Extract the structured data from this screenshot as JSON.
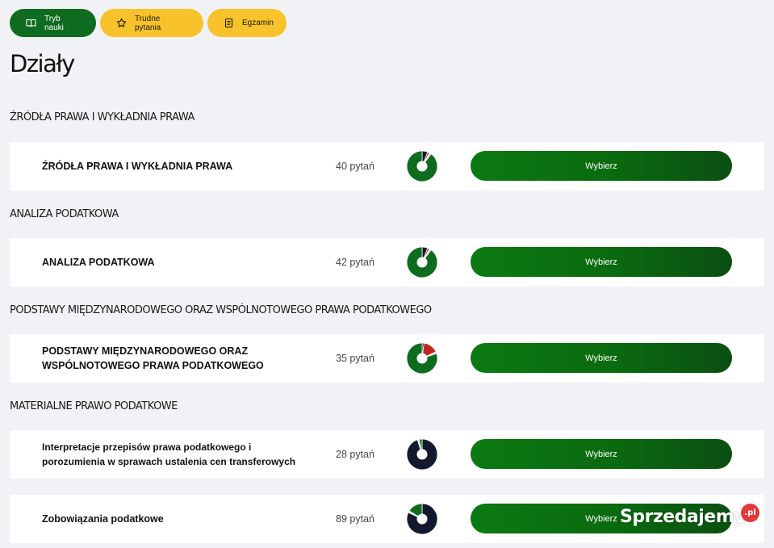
{
  "tabs": [
    {
      "label": "Tryb nauki",
      "icon": "book-icon"
    },
    {
      "label": "Trudne pytania",
      "icon": "star-icon"
    },
    {
      "label": "Egzamin",
      "icon": "document-icon"
    }
  ],
  "page_title": "Działy",
  "colors": {
    "green": "#0f6b1f",
    "yellow": "#f8c22a",
    "red": "#c0251d",
    "dark": "#141a2e",
    "light_gray": "#dcdcdc"
  },
  "sections": [
    {
      "title": "ŹRÓDŁA PRAWA I WYKŁADNIA PRAWA",
      "items": [
        {
          "name": "ŹRÓDŁA PRAWA I WYKŁADNIA PRAWA",
          "count": "40 pytań",
          "button": "Wybierz",
          "progress": {
            "correct": 0.9,
            "wrong": 0.02,
            "skipped": 0.02,
            "unanswered": 0.06
          }
        }
      ]
    },
    {
      "title": "ANALIZA PODATKOWA",
      "items": [
        {
          "name": "ANALIZA PODATKOWA",
          "count": "42 pytań",
          "button": "Wybierz",
          "progress": {
            "correct": 0.9,
            "wrong": 0.02,
            "skipped": 0.02,
            "unanswered": 0.06
          }
        }
      ]
    },
    {
      "title": "PODSTAWY MIĘDZYNARODOWEGO ORAZ WSPÓLNOTOWEGO PRAWA PODATKOWEGO",
      "items": [
        {
          "name": "PODSTAWY MIĘDZYNARODOWEGO ORAZ WSPÓLNOTOWEGO PRAWA PODATKOWEGO",
          "count": "35 pytań",
          "button": "Wybierz",
          "progress": {
            "correct": 0.8,
            "wrong": 0.16,
            "skipped": 0.02,
            "unanswered": 0.02
          }
        }
      ]
    },
    {
      "title": "MATERIALNE PRAWO PODATKOWE",
      "items": [
        {
          "name": "Interpretacje przepisów prawa podatkowego i porozumienia w sprawach ustalenia cen transferowych",
          "count": "28 pytań",
          "button": "Wybierz",
          "progress": {
            "correct": 0.03,
            "wrong": 0.0,
            "skipped": 0.02,
            "unanswered": 0.95
          }
        },
        {
          "name": "Zobowiązania podatkowe",
          "count": "89 pytań",
          "button": "Wybierz",
          "progress": {
            "correct": 0.16,
            "wrong": 0.0,
            "skipped": 0.02,
            "unanswered": 0.82
          }
        }
      ]
    }
  ],
  "watermark": {
    "text": "Sprzedajemy",
    "badge": ".pl"
  }
}
